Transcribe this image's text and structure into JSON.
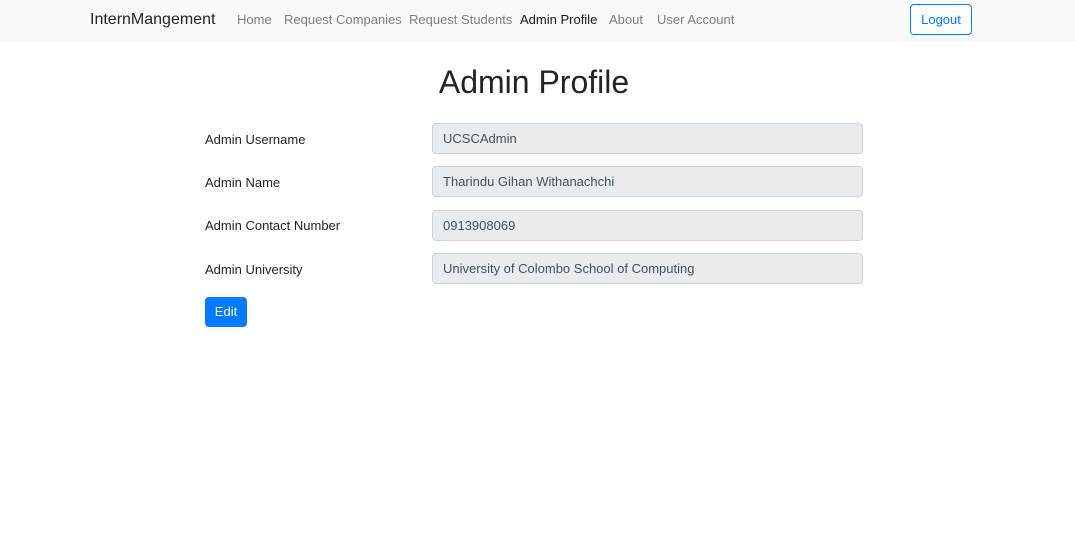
{
  "navbar": {
    "brand": "InternMangement",
    "links": [
      {
        "label": "Home"
      },
      {
        "label": "Request Companies"
      },
      {
        "label": "Request Students"
      },
      {
        "label": "Admin Profile",
        "active": true
      },
      {
        "label": "About"
      },
      {
        "label": "User Account"
      }
    ],
    "logout_label": "Logout"
  },
  "page": {
    "title": "Admin Profile"
  },
  "form": {
    "fields": [
      {
        "label": "Admin Username",
        "value": "UCSCAdmin"
      },
      {
        "label": "Admin Name",
        "value": "Tharindu Gihan Withanachchi"
      },
      {
        "label": "Admin Contact Number",
        "value": "0913908069"
      },
      {
        "label": "Admin University",
        "value": "University of Colombo School of Computing"
      }
    ],
    "edit_label": "Edit"
  },
  "colors": {
    "primary": "#007bff",
    "navbar_bg": "#f8f9fa",
    "readonly_field_bg": "#e9ecef"
  }
}
